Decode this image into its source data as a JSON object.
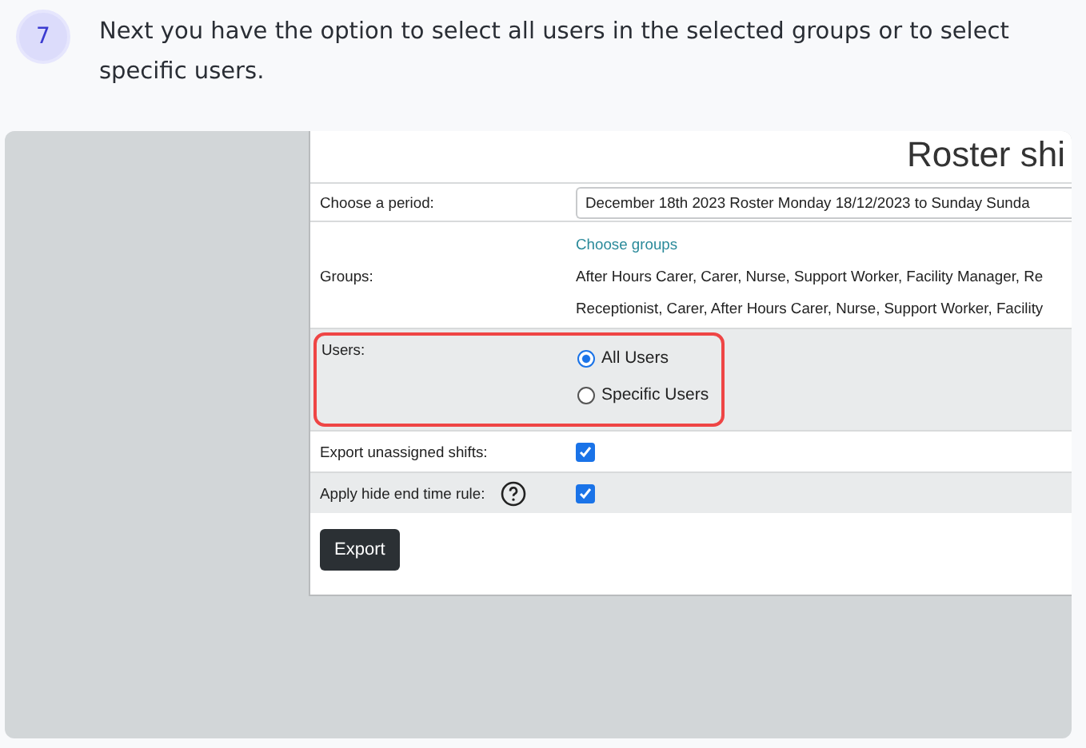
{
  "step": {
    "number": "7",
    "text": "Next you have the option to select all users in the selected groups or to select specific users."
  },
  "screenshot": {
    "heading": "Roster shi",
    "period": {
      "label": "Choose a period:",
      "value": "December 18th 2023 Roster Monday 18/12/2023 to Sunday Sunda"
    },
    "groups": {
      "label": "Groups:",
      "link": "Choose groups",
      "lines": [
        "After Hours Carer, Carer, Nurse, Support Worker, Facility Manager, Re",
        "Receptionist, Carer, After Hours Carer, Nurse, Support Worker, Facility"
      ]
    },
    "users": {
      "label": "Users:",
      "highlighted": true,
      "options": [
        {
          "label": "All Users",
          "selected": true
        },
        {
          "label": "Specific Users",
          "selected": false
        }
      ]
    },
    "checks": [
      {
        "label": "Export unassigned shifts:",
        "checked": true,
        "help": false
      },
      {
        "label": "Apply hide end time rule:",
        "checked": true,
        "help": true
      }
    ],
    "button": "Export"
  }
}
